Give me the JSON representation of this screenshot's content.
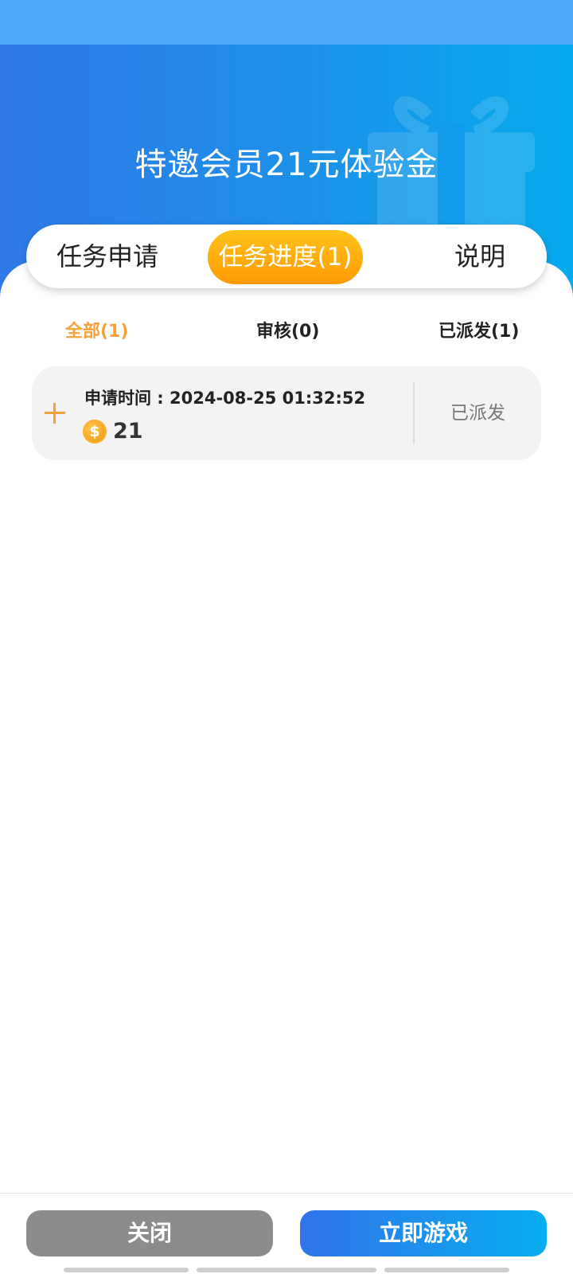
{
  "header": {
    "title": "特邀会员21元体验金"
  },
  "tabs": [
    {
      "label": "任务申请",
      "active": false
    },
    {
      "label": "任务进度(1)",
      "active": true
    },
    {
      "label": "说明",
      "active": false
    }
  ],
  "filters": [
    {
      "label": "全部(1)",
      "active": true
    },
    {
      "label": "审核(0)",
      "active": false
    },
    {
      "label": "已派发(1)",
      "active": false
    }
  ],
  "records": [
    {
      "apply_time": "申请时间 : 2024-08-25 01:32:52",
      "coin_symbol": "$",
      "amount": "21",
      "status": "已派发"
    }
  ],
  "footer": {
    "close_label": "关闭",
    "play_label": "立即游戏"
  },
  "colors": {
    "header_gradient_start": "#2f78e6",
    "header_gradient_end": "#06aaee",
    "active_tab": "#ffa80f",
    "accent_orange": "#f5a03a",
    "close_button": "#8c8c8c",
    "play_gradient_start": "#2f74e8",
    "play_gradient_end": "#08aef0"
  },
  "icons": {
    "expand": "plus-icon",
    "coin": "coin-icon",
    "header_decoration": "gift-icon"
  }
}
